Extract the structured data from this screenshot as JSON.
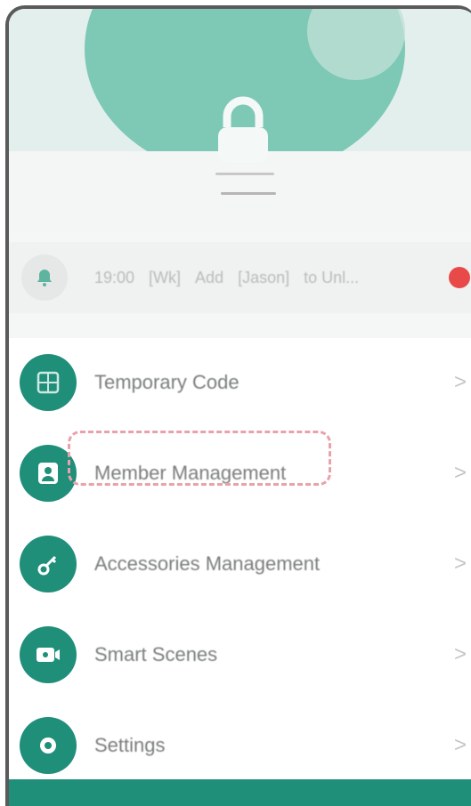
{
  "notice": {
    "segments": [
      "19:00",
      "[Wk]",
      "Add",
      "[Jason]",
      "to Unl..."
    ]
  },
  "menu": {
    "items": [
      {
        "label": "Temporary Code",
        "icon": "keypad-icon"
      },
      {
        "label": "Member Management",
        "icon": "person-icon"
      },
      {
        "label": "Accessories Management",
        "icon": "key-icon"
      },
      {
        "label": "Smart Scenes",
        "icon": "scene-icon"
      },
      {
        "label": "Settings",
        "icon": "gear-icon"
      }
    ],
    "chevron": ">"
  },
  "colors": {
    "accent": "#1f8f7a",
    "hero": "#6cc1ad",
    "badge": "#e84a4a",
    "highlight": "#e8a2aa"
  }
}
